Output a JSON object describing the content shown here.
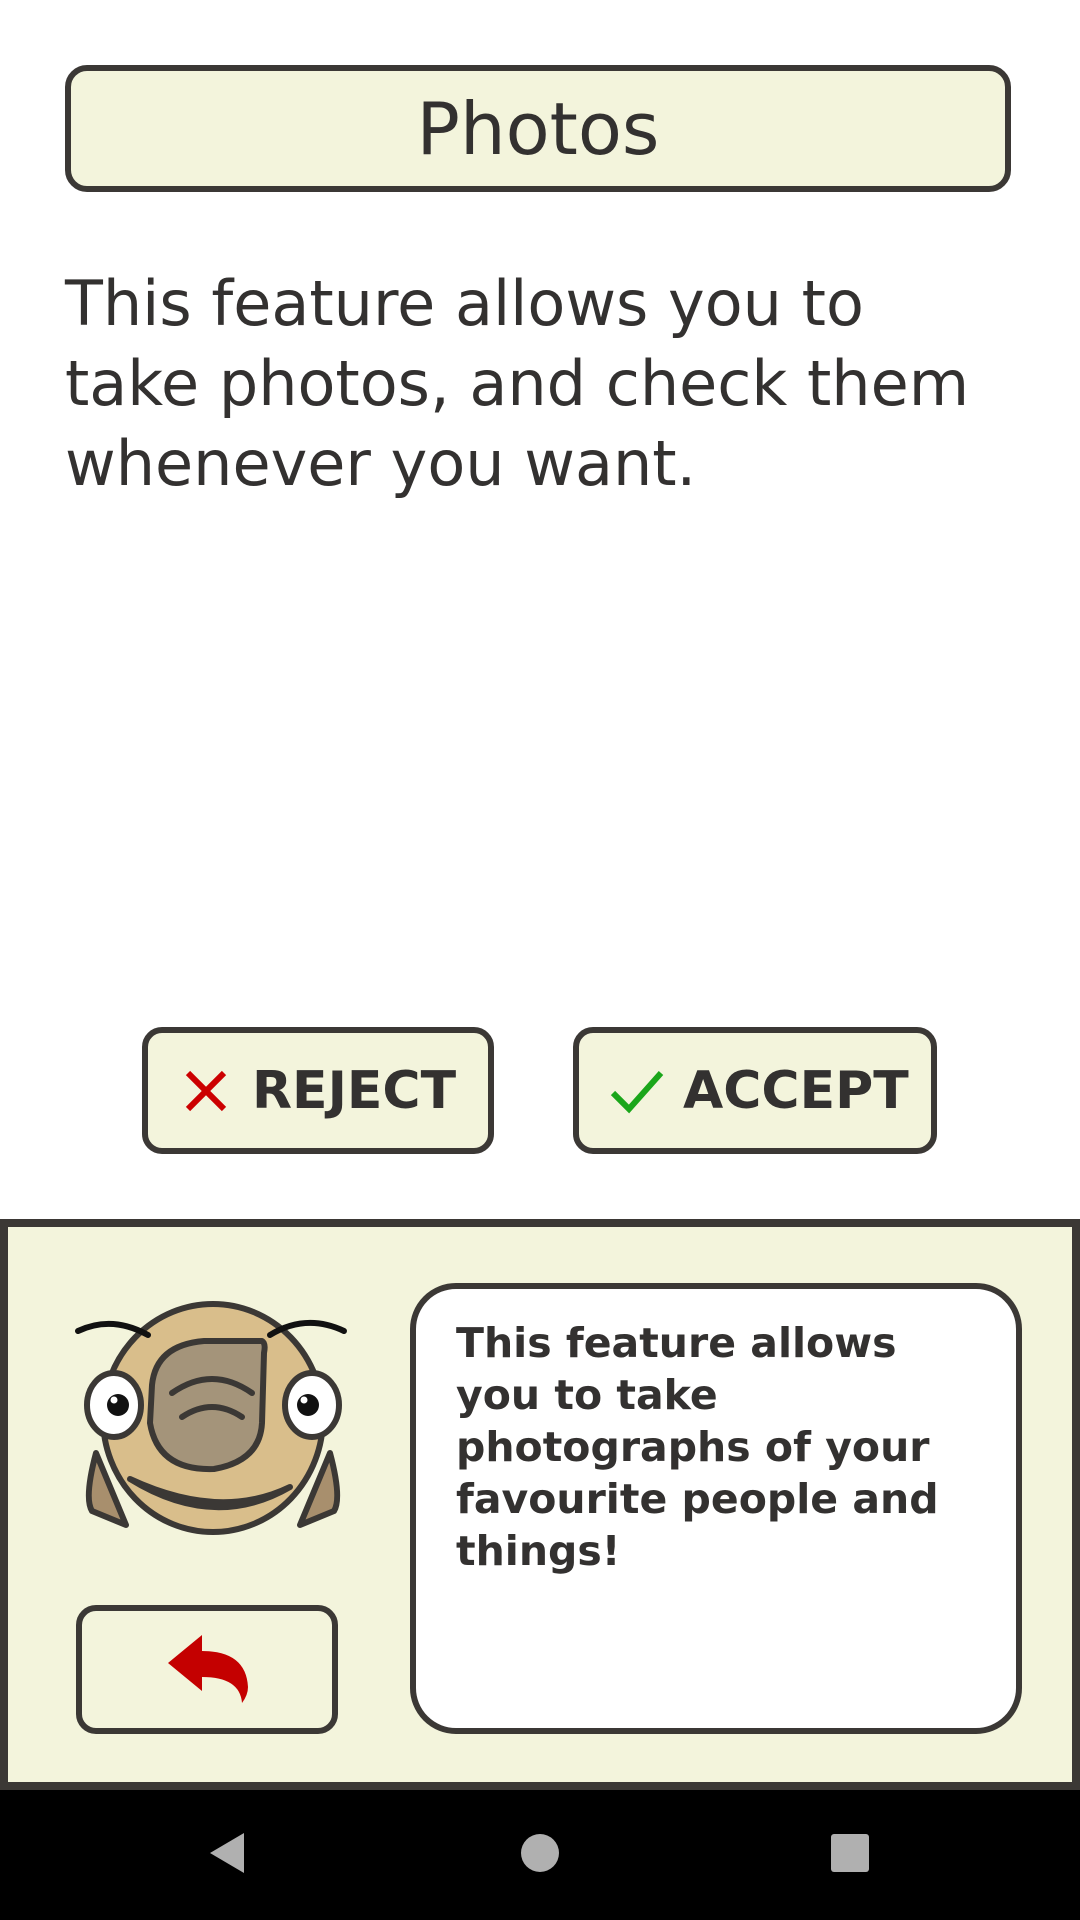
{
  "header": {
    "title": "Photos"
  },
  "main": {
    "description": "This feature allows you to take photos, and check them whenever you want."
  },
  "actions": {
    "reject_label": "REJECT",
    "accept_label": "ACCEPT",
    "reject_icon": "close-icon",
    "accept_icon": "checkmark-icon",
    "reject_icon_color": "#cc0000",
    "accept_icon_color": "#1aa61a"
  },
  "assistant": {
    "message": "This feature allows you to take photographs of your favourite people and things!",
    "mascot_icon": "mascot-face-icon",
    "back_icon": "undo-arrow-icon",
    "back_icon_color": "#c40000"
  },
  "navigation": {
    "back_icon": "nav-back-icon",
    "home_icon": "nav-home-icon",
    "recents_icon": "nav-recents-icon"
  },
  "colors": {
    "panel_background": "#f3f4dc",
    "border": "#3b3835",
    "text": "#333130"
  }
}
